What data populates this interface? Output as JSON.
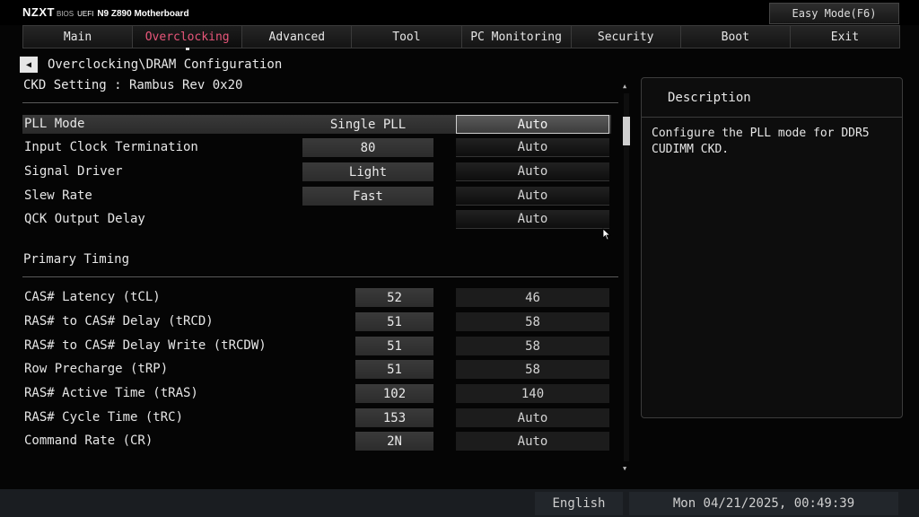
{
  "header": {
    "brand": "NZXT",
    "bios": "BIOS",
    "uefi": "UEFI",
    "model": "N9 Z890 Motherboard",
    "easy_mode": "Easy Mode(F6)"
  },
  "tabs": [
    {
      "label": "Main"
    },
    {
      "label": "Overclocking"
    },
    {
      "label": "Advanced"
    },
    {
      "label": "Tool"
    },
    {
      "label": "PC Monitoring"
    },
    {
      "label": "Security"
    },
    {
      "label": "Boot"
    },
    {
      "label": "Exit"
    }
  ],
  "active_tab": "Overclocking",
  "accent_color": "#e8567a",
  "breadcrumb": "Overclocking\\DRAM Configuration",
  "ckd_setting": "CKD Setting : Rambus Rev 0x20",
  "ckd_rows": [
    {
      "label": "PLL Mode",
      "current": "Single PLL",
      "value": "Auto"
    },
    {
      "label": "Input Clock Termination",
      "current": "80",
      "value": "Auto"
    },
    {
      "label": "Signal Driver",
      "current": "Light",
      "value": "Auto"
    },
    {
      "label": "Slew Rate",
      "current": "Fast",
      "value": "Auto"
    },
    {
      "label": "QCK Output Delay",
      "current": "",
      "value": "Auto"
    }
  ],
  "primary_timing_title": "Primary Timing",
  "timing_rows": [
    {
      "label": "CAS# Latency (tCL)",
      "current": "52",
      "value": "46"
    },
    {
      "label": "RAS# to CAS# Delay (tRCD)",
      "current": "51",
      "value": "58"
    },
    {
      "label": "RAS# to CAS# Delay Write (tRCDW)",
      "current": "51",
      "value": "58"
    },
    {
      "label": "Row Precharge (tRP)",
      "current": "51",
      "value": "58"
    },
    {
      "label": "RAS# Active Time (tRAS)",
      "current": "102",
      "value": "140"
    },
    {
      "label": "RAS# Cycle Time (tRC)",
      "current": "153",
      "value": "Auto"
    },
    {
      "label": "Command Rate (CR)",
      "current": "2N",
      "value": "Auto"
    }
  ],
  "description": {
    "title": "Description",
    "text": "Configure the PLL mode for DDR5\nCUDIMM CKD."
  },
  "footer": {
    "language": "English",
    "datetime": "Mon 04/21/2025, 00:49:39"
  }
}
